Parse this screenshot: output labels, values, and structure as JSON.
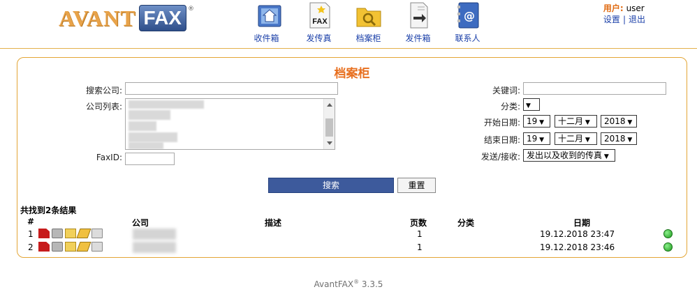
{
  "brand": {
    "logo_left": "AVANT",
    "logo_right": "FAX",
    "logo_mark": "®"
  },
  "nav": [
    {
      "label": "收件箱",
      "icon": "inbox-icon"
    },
    {
      "label": "发传真",
      "icon": "fax-icon"
    },
    {
      "label": "档案柜",
      "icon": "archive-folder-icon"
    },
    {
      "label": "发件箱",
      "icon": "outbox-icon"
    },
    {
      "label": "联系人",
      "icon": "contacts-icon"
    }
  ],
  "user": {
    "label": "用户:",
    "name": "user",
    "settings": "设置",
    "sep": "|",
    "logout": "退出"
  },
  "page": {
    "title": "档案柜"
  },
  "form": {
    "search_company_label": "搜索公司:",
    "company_list_label": "公司列表:",
    "faxid_label": "FaxID:",
    "keyword_label": "关键词:",
    "category_label": "分类:",
    "start_date_label": "开始日期:",
    "end_date_label": "结束日期:",
    "direction_label": "发送/接收:",
    "start_day": "19",
    "start_month": "十二月",
    "start_year": "2018",
    "end_day": "19",
    "end_month": "十二月",
    "end_year": "2018",
    "direction_value": "发出以及收到的传真",
    "search_button": "搜索",
    "reset_button": "重置"
  },
  "results": {
    "count_text": "共找到2条结果",
    "headers": {
      "num": "#",
      "company": "公司",
      "description": "描述",
      "pages": "页数",
      "category": "分类",
      "date": "日期"
    },
    "rows": [
      {
        "num": "1",
        "pages": "1",
        "date": "19.12.2018 23:47"
      },
      {
        "num": "2",
        "pages": "1",
        "date": "19.12.2018 23:46"
      }
    ]
  },
  "footer": {
    "product": "AvantFAX",
    "mark": "®",
    "version": "3.3.5"
  },
  "colors": {
    "accent_orange": "#e87020",
    "link_blue": "#1a3fa8",
    "button_blue": "#3d5a9c",
    "border_gold": "#e3a535"
  }
}
